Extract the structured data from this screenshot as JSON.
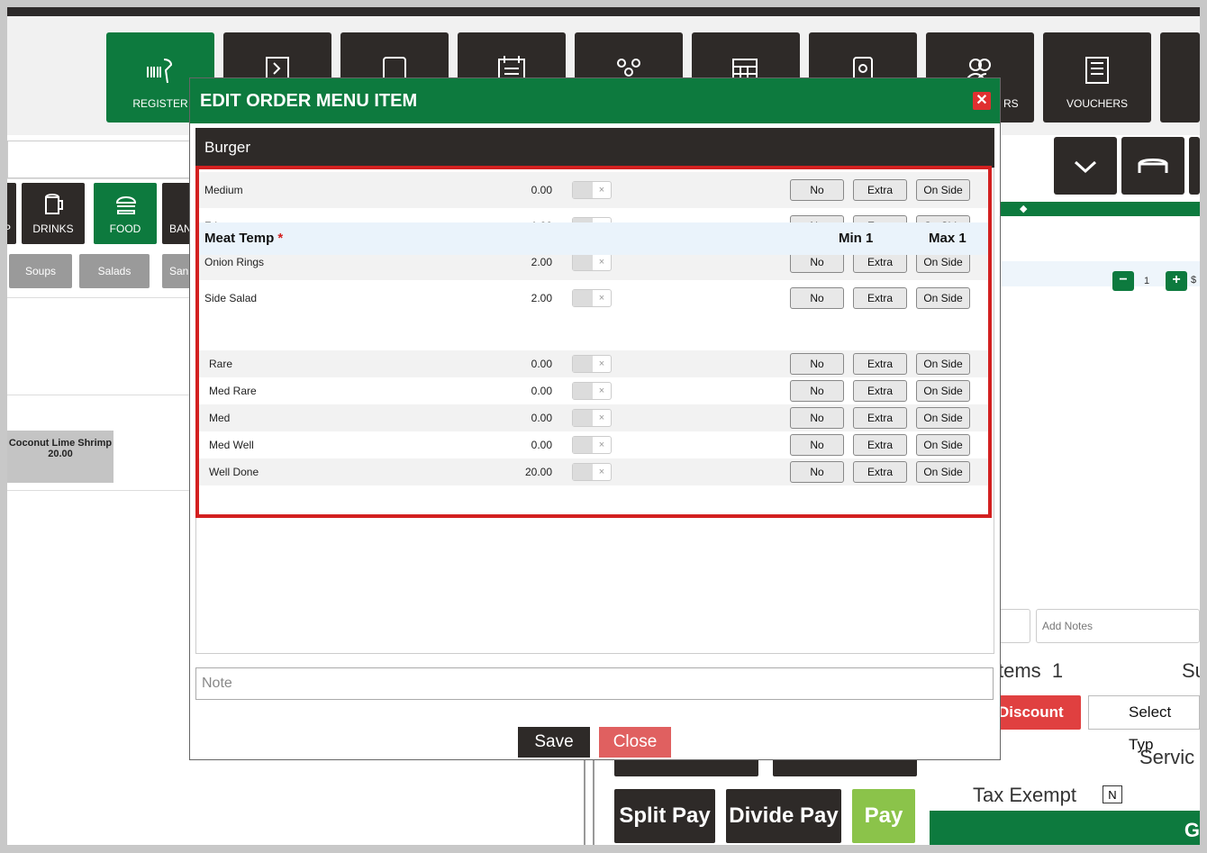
{
  "nav": {
    "register": "REGISTER",
    "rs_partial": "RS",
    "vouchers": "VOUCHERS"
  },
  "categories": {
    "p_partial": "P",
    "drinks": "DRINKS",
    "food": "FOOD",
    "ban_partial": "BAN"
  },
  "subcategories": {
    "soups": "Soups",
    "salads": "Salads",
    "san_partial": "San"
  },
  "product": {
    "name": "Coconut Lime Shrimp",
    "price": "20.00"
  },
  "order": {
    "qty": "1",
    "price_partial": "$",
    "add_notes_placeholder": "Add Notes",
    "items_label": "tems",
    "items_count": "1",
    "sub_partial": "Su",
    "discount": "Discount",
    "select_type": "Select Typ",
    "service_partial": "Servic",
    "tax_exempt": "Tax Exempt",
    "tax_exempt_flag": "N",
    "go_partial": "G"
  },
  "pay": {
    "split": "Split Pay",
    "divide": "Divide Pay",
    "pay": "Pay"
  },
  "modal": {
    "title": "EDIT ORDER MENU ITEM",
    "item_name": "Burger",
    "options_top": [
      {
        "name": "Medium",
        "price": "0.00"
      },
      {
        "name": "Fries",
        "price": "1.00"
      },
      {
        "name": "Onion Rings",
        "price": "2.00"
      },
      {
        "name": "Side Salad",
        "price": "2.00"
      }
    ],
    "group": {
      "title": "Meat Temp",
      "required_mark": "*",
      "min": "Min 1",
      "max": "Max 1"
    },
    "options_temp": [
      {
        "name": "Rare",
        "price": "0.00"
      },
      {
        "name": "Med Rare",
        "price": "0.00"
      },
      {
        "name": "Med",
        "price": "0.00"
      },
      {
        "name": "Med Well",
        "price": "0.00"
      },
      {
        "name": "Well Done",
        "price": "20.00"
      }
    ],
    "btn_no": "No",
    "btn_extra": "Extra",
    "btn_side": "On Side",
    "toggle_x": "×",
    "note_placeholder": "Note",
    "save": "Save",
    "close": "Close"
  },
  "colors": {
    "brand_green": "#0d7a3e",
    "dark": "#2e2a28",
    "highlight": "#d32020",
    "close_red": "#e06060",
    "pay_green": "#8bc34a"
  }
}
